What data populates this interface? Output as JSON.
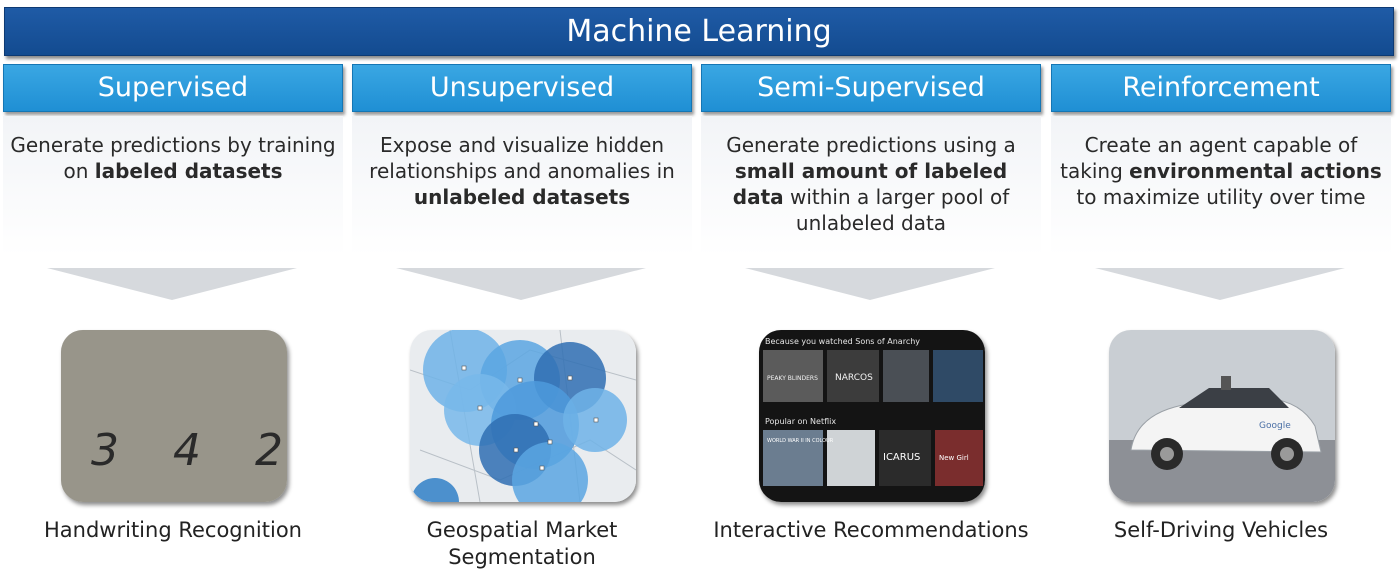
{
  "title": "Machine Learning",
  "columns": [
    {
      "header": "Supervised",
      "description": [
        {
          "text": "Generate predictions by training on ",
          "bold": false
        },
        {
          "text": "labeled datasets",
          "bold": true
        }
      ],
      "caption": "Handwriting Recognition",
      "image_text": "3 4 2"
    },
    {
      "header": "Unsupervised",
      "description": [
        {
          "text": "Expose and visualize hidden relationships and anomalies in ",
          "bold": false
        },
        {
          "text": "unlabeled datasets",
          "bold": true
        }
      ],
      "caption": "Geospatial Market Segmentation"
    },
    {
      "header": "Semi-Supervised",
      "description": [
        {
          "text": "Generate predictions using a ",
          "bold": false
        },
        {
          "text": "small amount of labeled data",
          "bold": true
        },
        {
          "text": " within a larger pool of unlabeled data",
          "bold": false
        }
      ],
      "caption": "Interactive Recommendations",
      "image_text": {
        "row1_label": "Because you watched Sons of Anarchy",
        "row1_titles": [
          "PEAKY BLINDERS",
          "NARCOS"
        ],
        "row2_label": "Popular on Netflix",
        "row2_titles": [
          "WORLD WAR II IN COLOUR",
          "ICARUS",
          "New Girl"
        ]
      }
    },
    {
      "header": "Reinforcement",
      "description": [
        {
          "text": "Create an agent capable of taking ",
          "bold": false
        },
        {
          "text": "environmental actions",
          "bold": true
        },
        {
          "text": " to maximize utility over time",
          "bold": false
        }
      ],
      "caption": "Self-Driving Vehicles",
      "image_text": "Google"
    }
  ]
}
